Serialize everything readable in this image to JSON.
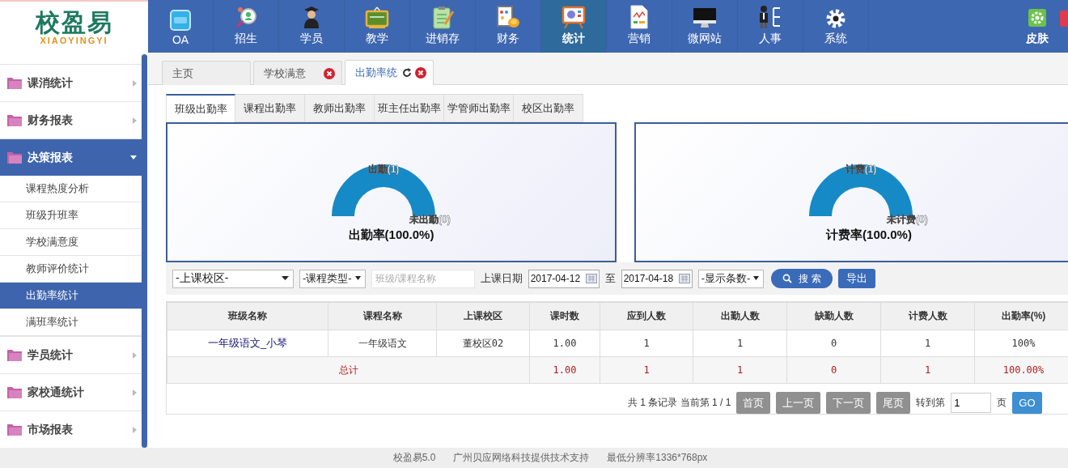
{
  "logo": {
    "name": "校盈易",
    "subtitle": "XIAOYINGYI"
  },
  "nav": [
    {
      "label": "OA",
      "selected": false
    },
    {
      "label": "招生",
      "selected": false
    },
    {
      "label": "学员",
      "selected": false
    },
    {
      "label": "教学",
      "selected": false
    },
    {
      "label": "进销存",
      "selected": false
    },
    {
      "label": "财务",
      "selected": false
    },
    {
      "label": "统计",
      "selected": true
    },
    {
      "label": "营销",
      "selected": false
    },
    {
      "label": "微网站",
      "selected": false
    },
    {
      "label": "人事",
      "selected": false
    },
    {
      "label": "系统",
      "selected": false
    }
  ],
  "skin": {
    "label": "皮肤"
  },
  "sidebar": {
    "items": [
      {
        "label": "课消统计",
        "expanded": false
      },
      {
        "label": "财务报表",
        "expanded": false
      },
      {
        "label": "决策报表",
        "expanded": true,
        "children": [
          {
            "label": "课程热度分析",
            "selected": false
          },
          {
            "label": "班级升班率",
            "selected": false
          },
          {
            "label": "学校满意度",
            "selected": false
          },
          {
            "label": "教师评价统计",
            "selected": false
          },
          {
            "label": "出勤率统计",
            "selected": true
          },
          {
            "label": "满班率统计",
            "selected": false
          }
        ]
      },
      {
        "label": "学员统计",
        "expanded": false
      },
      {
        "label": "家校通统计",
        "expanded": false
      },
      {
        "label": "市场报表",
        "expanded": false
      }
    ]
  },
  "page_tabs": [
    {
      "label": "主页",
      "selected": false,
      "closable": false,
      "refreshable": false
    },
    {
      "label": "学校满意",
      "selected": false,
      "closable": true,
      "refreshable": false
    },
    {
      "label": "出勤率统",
      "selected": true,
      "closable": true,
      "refreshable": true
    }
  ],
  "sub_tabs": [
    {
      "label": "班级出勤率",
      "selected": true
    },
    {
      "label": "课程出勤率",
      "selected": false
    },
    {
      "label": "教师出勤率",
      "selected": false
    },
    {
      "label": "班主任出勤率",
      "selected": false
    },
    {
      "label": "学管师出勤率",
      "selected": false
    },
    {
      "label": "校区出勤率",
      "selected": false
    }
  ],
  "charts": [
    {
      "title": "出勤率(100.0%)",
      "filled_label": "出勤(1)",
      "empty_label": "未出勤(0)"
    },
    {
      "title": "计费率(100.0%)",
      "filled_label": "计费(1)",
      "empty_label": "未计费(0)"
    }
  ],
  "filters": {
    "campus": "-上课校区-",
    "course_type": "-课程类型-",
    "search": {
      "placeholder": "班级/课程名称"
    },
    "date_label": "上课日期",
    "date_from": "2017-04-12",
    "date_sep": "至",
    "date_to": "2017-04-18",
    "page_size": "-显示条数-",
    "search_button": "搜 索",
    "export_button": "导出"
  },
  "table": {
    "columns": [
      "班级名称",
      "课程名称",
      "上课校区",
      "课时数",
      "应到人数",
      "出勤人数",
      "缺勤人数",
      "计费人数",
      "出勤率(%)"
    ],
    "rows": [
      [
        "一年级语文_小琴",
        "一年级语文",
        "董校区02",
        "1.00",
        "1",
        "1",
        "0",
        "1",
        "100%"
      ]
    ],
    "total": {
      "label": "总计",
      "values": [
        "1.00",
        "1",
        "1",
        "0",
        "1",
        "100.00%"
      ]
    }
  },
  "pagination": {
    "summary": "共 1 条记录 当前第 1 / 1",
    "buttons": [
      "首页",
      "上一页",
      "下一页",
      "尾页"
    ],
    "goto_label": "转到第",
    "page": "1",
    "unit": "页",
    "go": "GO"
  },
  "footer": [
    "校盈易5.0",
    "广州贝应网络科技提供技术支持",
    "最低分辨率1336*768px"
  ]
}
